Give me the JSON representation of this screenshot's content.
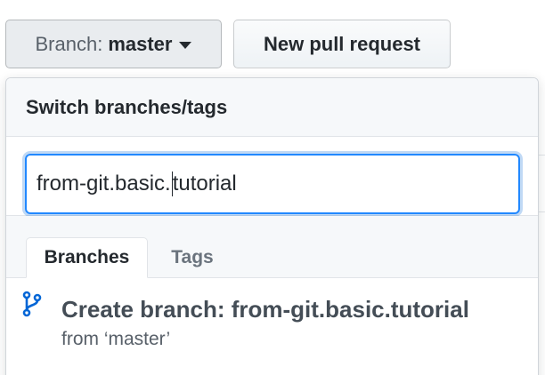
{
  "toolbar": {
    "branch_prefix": "Branch:",
    "branch_value": "master",
    "new_pr_label": "New pull request"
  },
  "dropdown": {
    "title": "Switch branches/tags",
    "filter_before_cursor": "from-git.basic.",
    "filter_after_cursor": "tutorial",
    "tabs": [
      {
        "label": "Branches",
        "active": true
      },
      {
        "label": "Tags",
        "active": false
      }
    ],
    "create_item": {
      "title": "Create branch: from-git.basic.tutorial",
      "subtitle": "from ‘master’"
    }
  },
  "colors": {
    "focus_border": "#2188ff",
    "branch_icon": "#0366d6",
    "header_bg": "#f6f8fa"
  },
  "icons": {
    "branch": "git-branch-icon",
    "caret": "caret-down-icon"
  }
}
